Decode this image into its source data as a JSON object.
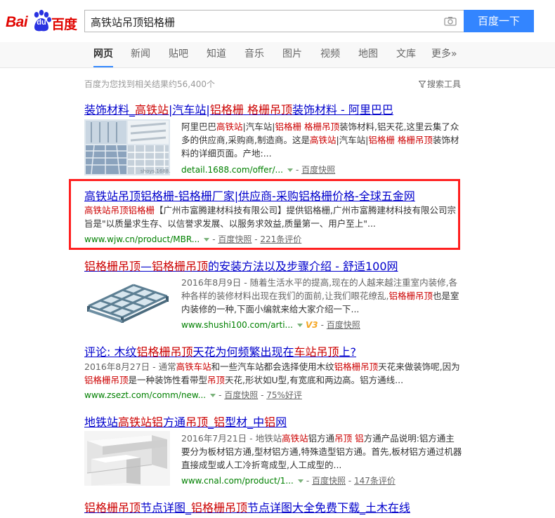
{
  "brand": {
    "bai": "Bai",
    "du": "du",
    "cn": "百度",
    "red": "#e10602",
    "blue": "#3385ff"
  },
  "search": {
    "query": "高铁站吊顶铝格栅",
    "button": "百度一下"
  },
  "nav": {
    "tabs": [
      "网页",
      "新闻",
      "贴吧",
      "知道",
      "音乐",
      "图片",
      "视频",
      "地图",
      "文库",
      "更多»"
    ],
    "active": 0
  },
  "result_count": "百度为您找到相关结果约56,400个",
  "search_tools": "搜索工具",
  "results": [
    {
      "title_parts": [
        "装饰材料_",
        "高铁站",
        "|汽车站|",
        "铝格栅",
        " ",
        "格栅吊顶",
        "装饰材料 - 阿里巴巴"
      ],
      "abstract_parts": [
        "阿里巴巴",
        "高铁站",
        "|汽车站|",
        "铝格栅",
        " ",
        "格栅吊顶",
        "装饰材料,铝天花,这里云集了众多的供应商,采购商,制造商。这是",
        "高铁站",
        "|汽车站|",
        "铝格栅",
        " ",
        "格栅吊顶",
        "装饰材料的详细页面。产地:..."
      ],
      "url": "detail.1688.com/offer/...",
      "snapshot": "百度快照",
      "thumb": "ceiling-grid-collage",
      "thumb_caption": "shoys.1688.com"
    },
    {
      "title": "高铁站吊顶铝格栅-铝格栅厂家|供应商-采购铝格栅价格-全球五金网",
      "abstract_parts": [
        "高铁站吊顶铝格栅",
        "【广州市富腾建材科技有限公司】提供铝格栅,广州市富腾建材科技有限公司宗旨是\"以质量求生存、以信誉求发展、以服务求效益,质量第一、用户至上\"..."
      ],
      "url": "www.wjw.cn/product/MBR...",
      "snapshot": "百度快照",
      "reviews": "221条评价"
    },
    {
      "title_parts": [
        "铝格栅吊顶",
        "—",
        "铝格栅吊顶",
        "的安装方法以及步骤介绍 - 舒适100网"
      ],
      "abstract_parts": [
        "2016年8月9日 - 随着生活水平的提高,现在的人越来越注重室内装修,各种各样的装修材料出现在我们的面前,让我们眼花缭乱,",
        "铝格栅吊顶",
        "也是室内装修的一种,下面小编就来给大家介绍一下..."
      ],
      "url": "www.shushi100.com/arti...",
      "v_badge": "V3",
      "snapshot": "百度快照",
      "thumb": "grid-ceiling-3d"
    },
    {
      "title_parts": [
        "评论: 木纹",
        "铝格栅吊顶",
        "天花为何频繁出现在",
        "车站吊顶",
        "上?"
      ],
      "abstract_parts": [
        "2016年8月27日 - 通常",
        "高铁车站",
        "和一些汽车站都会选择使用木纹",
        "铝格栅吊顶",
        "天花来做装饰呢,因为",
        "铝格栅吊顶",
        "是一种装饰性看带型",
        "吊顶",
        "天花,形状如U型,有宽底和两边高。铝方通线..."
      ],
      "url": "www.zsezt.com/comm/new...",
      "snapshot": "百度快照",
      "reviews": "75%好评"
    },
    {
      "title_parts": [
        "地铁站",
        "高铁站",
        "铝",
        "方通",
        "吊顶",
        "_",
        "铝",
        "型材_中",
        "铝",
        "网"
      ],
      "abstract_parts": [
        "2016年7月21日 - 地铁站",
        "高铁站",
        "铝方通",
        "吊顶",
        " ",
        "铝",
        "方通产品说明:铝方通主要分为板材铝方通,型材铝方通,特殊造型铝方通。首先,板材铝方通过机器直接成型或人工冷折弯成型,人工成型的..."
      ],
      "url": "www.cnal.com/product/1...",
      "snapshot": "百度快照",
      "reviews": "147条评价",
      "thumb": "white-u-channels"
    },
    {
      "title_parts": [
        "铝格栅吊顶",
        "节点详图_",
        "铝格栅吊顶",
        "节点详图大全免费下载_土木在线"
      ]
    }
  ]
}
